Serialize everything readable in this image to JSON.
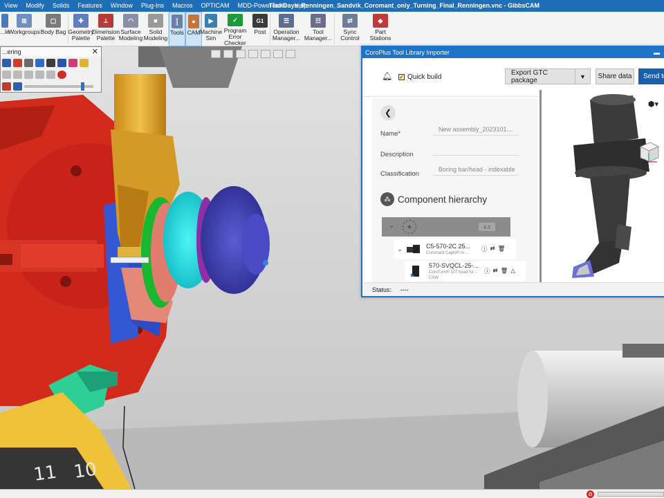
{
  "menu": {
    "items": [
      "View",
      "Modify",
      "Solids",
      "Features",
      "Window",
      "Plug-Ins",
      "Macros",
      "OPTICAM",
      "MDD-PowerTools",
      "Help"
    ],
    "window_title": "TechDays_Renningen_Sandvik_Coromant_only_Turning_Final_Renningen.vnc - GibbsCAM"
  },
  "ribbon": {
    "buttons": [
      {
        "label": "...lette",
        "icon": "palette-icon"
      },
      {
        "label": "Workgroups",
        "icon": "workgroups-icon"
      },
      {
        "label": "Body Bag",
        "icon": "body-bag-icon"
      },
      {
        "label": "Geometry Palette",
        "icon": "geometry-palette-icon"
      },
      {
        "label": "Dimension Palette",
        "icon": "dimension-palette-icon"
      },
      {
        "label": "Surface Modeling",
        "icon": "surface-modeling-icon"
      },
      {
        "label": "Solid Modeling",
        "icon": "solid-modeling-icon"
      },
      {
        "label": "Tools",
        "icon": "tools-icon"
      },
      {
        "label": "CAM",
        "icon": "cam-icon"
      },
      {
        "label": "Machine Sim",
        "icon": "machine-sim-icon"
      },
      {
        "label": "Program Error Checker",
        "icon": "error-checker-icon"
      },
      {
        "label": "Post",
        "icon": "post-icon"
      },
      {
        "label": "Operation Manager...",
        "icon": "operation-manager-icon"
      },
      {
        "label": "Tool Manager...",
        "icon": "tool-manager-icon"
      },
      {
        "label": "Sync Control",
        "icon": "sync-control-icon"
      },
      {
        "label": "Part Stations",
        "icon": "part-stations-icon"
      }
    ]
  },
  "palette": {
    "title": "...ering"
  },
  "dialog": {
    "title": "CoroPlus Tool Library Importer",
    "quick_build_label": "Quick build",
    "export_label": "Export GTC package",
    "share_label": "Share data",
    "send_label": "Send to",
    "fields": {
      "name_label": "Name*",
      "name_value": "New assembly_2023101...",
      "description_label": "Description",
      "description_value": "",
      "classification_label": "Classification",
      "classification_value": "Boring bar/head - indexable"
    },
    "hierarchy_title": "Component hierarchy",
    "assembly_count": "4.5",
    "components": [
      {
        "name": "C5-570-2C 25...",
        "desc": "Coromant Capto® to ..."
      },
      {
        "name": "570-SVQCL-25-...",
        "desc": "CoroTurn® 107 head for ... CSW"
      }
    ],
    "status_label": "Status:",
    "status_value": "----"
  },
  "colors": {
    "accent": "#1c73c9",
    "title_bar": "#1f6fb8",
    "send_button": "#1660ad"
  }
}
